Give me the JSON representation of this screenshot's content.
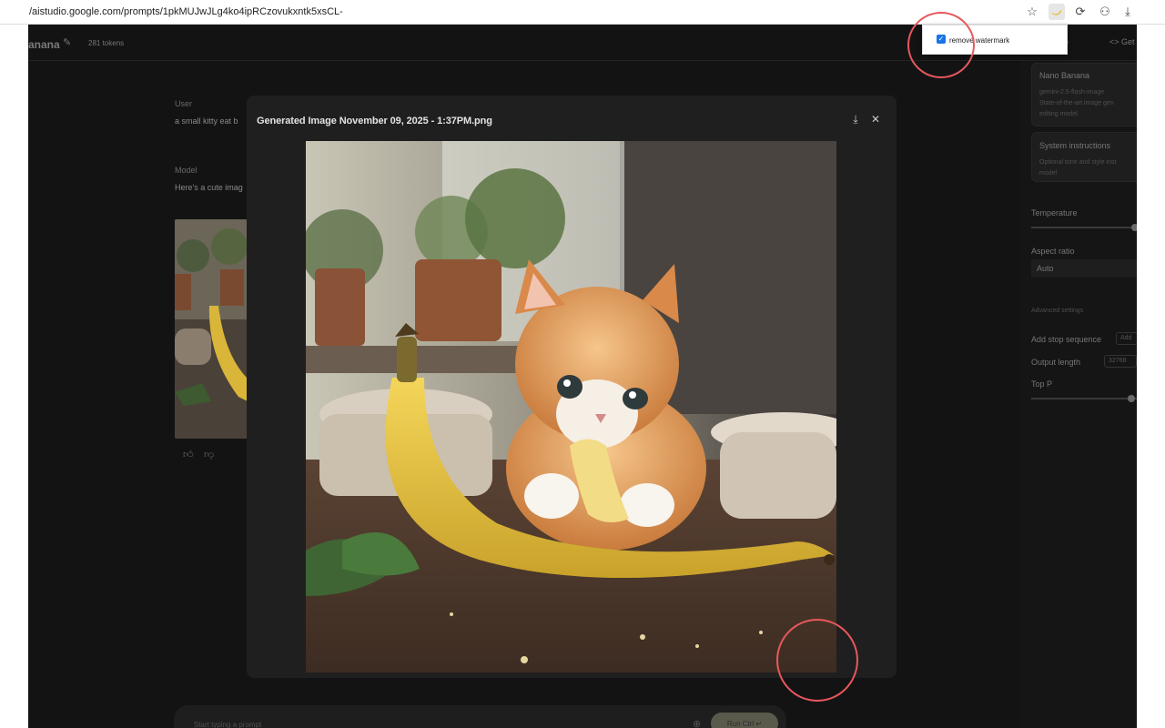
{
  "browser": {
    "url": "/aistudio.google.com/prompts/1pkMUJwJLg4ko4ipRCzovukxntk5xsCL-"
  },
  "app": {
    "title_fragment": "anana",
    "tokens": "281 tokens",
    "get_code": "<> Get",
    "header_fragment": "p"
  },
  "chat": {
    "user_label": "User",
    "user_text": "a small kitty eat b",
    "model_label": "Model",
    "model_text": "Here's a cute imag"
  },
  "right_panel": {
    "model_card_title": "Nano Banana",
    "model_card_sub1": "gemini-2.5-flash-image",
    "model_card_sub2": "State-of-the-art image gen",
    "model_card_sub3": "editing model.",
    "sys_title": "System instructions",
    "sys_sub1": "Optional tone and style inst",
    "sys_sub2": "model",
    "temperature_label": "Temperature",
    "aspect_label": "Aspect ratio",
    "aspect_value": "Auto",
    "advanced_label": "Advanced settings",
    "stop_label": "Add stop sequence",
    "stop_input": "Add",
    "output_label": "Output length",
    "output_value": "32768",
    "topp_label": "Top P"
  },
  "prompt": {
    "placeholder": "Start typing a prompt",
    "run_label": "Run  Ctrl ↵"
  },
  "modal": {
    "title": "Generated Image November 09, 2025 - 1:37PM.png"
  },
  "extension_popup": {
    "label": "remove watermark",
    "checked": true
  },
  "colors": {
    "app_bg": "#131314",
    "modal_bg": "#1f1f1f",
    "annotation": "#e8585c",
    "checkbox": "#1a73e8"
  }
}
